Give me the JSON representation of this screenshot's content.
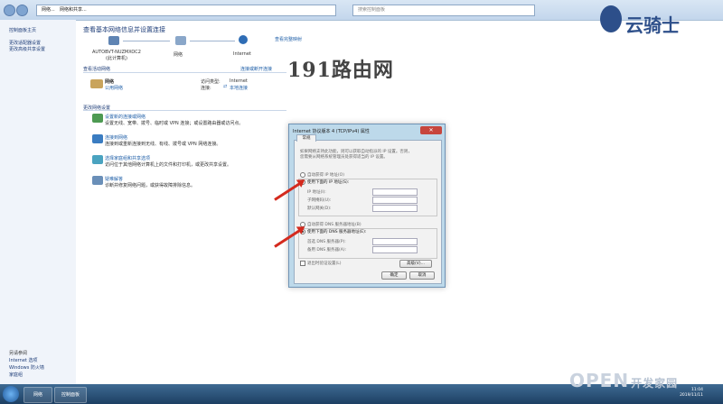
{
  "address": {
    "crumb1": "网络...",
    "crumb2": "网络和共享...",
    "search": "搜索控制面板"
  },
  "left": {
    "home": "控制面板主页",
    "items": [
      "更改适配器设置",
      "更改高级共享设置"
    ],
    "see_also_title": "另请参阅",
    "see_also": [
      "Internet 选项",
      "Windows 防火墙",
      "家庭组"
    ]
  },
  "main": {
    "title": "查看基本网络信息并设置连接",
    "view_full_map": "查看完整映射",
    "map_nodes": [
      "AUTOBVT-NUZMXOC2\n(此计算机)",
      "网络",
      "Internet"
    ],
    "active_title": "查看活动网络",
    "connect_or_disconnect": "连接或断开连接",
    "network_name": "网络",
    "network_type": "公用网络",
    "access_type_label": "访问类型:",
    "access_type_value": "Internet",
    "connections_label": "连接:",
    "connections_value": "本地连接",
    "change_title": "更改网络设置",
    "tasks": [
      {
        "title": "设置新的连接或网络",
        "desc": "设置无线、宽带、拨号、临时或 VPN 连接；或设置路由器或访问点。"
      },
      {
        "title": "连接到网络",
        "desc": "连接到或重新连接到无线、有线、拨号或 VPN 网络连接。"
      },
      {
        "title": "选择家庭组和共享选项",
        "desc": "访问位于其他网络计算机上的文件和打印机，或更改共享设置。"
      },
      {
        "title": "疑难解答",
        "desc": "诊断并修复网络问题，或获得故障排除信息。"
      }
    ]
  },
  "watermark": "191路由网",
  "dialog": {
    "title": "Internet 协议版本 4 (TCP/IPv4) 属性",
    "close": "✕",
    "tab": "常规",
    "intro": "如果网络支持此功能，则可以获取自动指派的 IP 设置。否则，\n您需要从网络系统管理员处获得适当的 IP 设置。",
    "auto_ip": "自动获得 IP 地址(O)",
    "manual_ip": "使用下面的 IP 地址(S):",
    "ip_label": "IP 地址(I):",
    "mask_label": "子网掩码(U):",
    "gateway_label": "默认网关(D):",
    "auto_dns": "自动获得 DNS 服务器地址(B)",
    "manual_dns": "使用下面的 DNS 服务器地址(E):",
    "pref_dns": "首选 DNS 服务器(P):",
    "alt_dns": "备用 DNS 服务器(A):",
    "validate": "退出时验证设置(L)",
    "advanced": "高级(V)...",
    "ok": "确定",
    "cancel": "取消"
  },
  "taskbar": {
    "items": [
      "网络",
      "控制面板"
    ],
    "time": "11:04",
    "date": "2019/11/11"
  },
  "brand": {
    "name": "云骑士",
    "open": "OPEN",
    "open_sub": "开发家园"
  },
  "colors": {
    "accent": "#1f5fa8",
    "arrow": "#d42a1e"
  }
}
